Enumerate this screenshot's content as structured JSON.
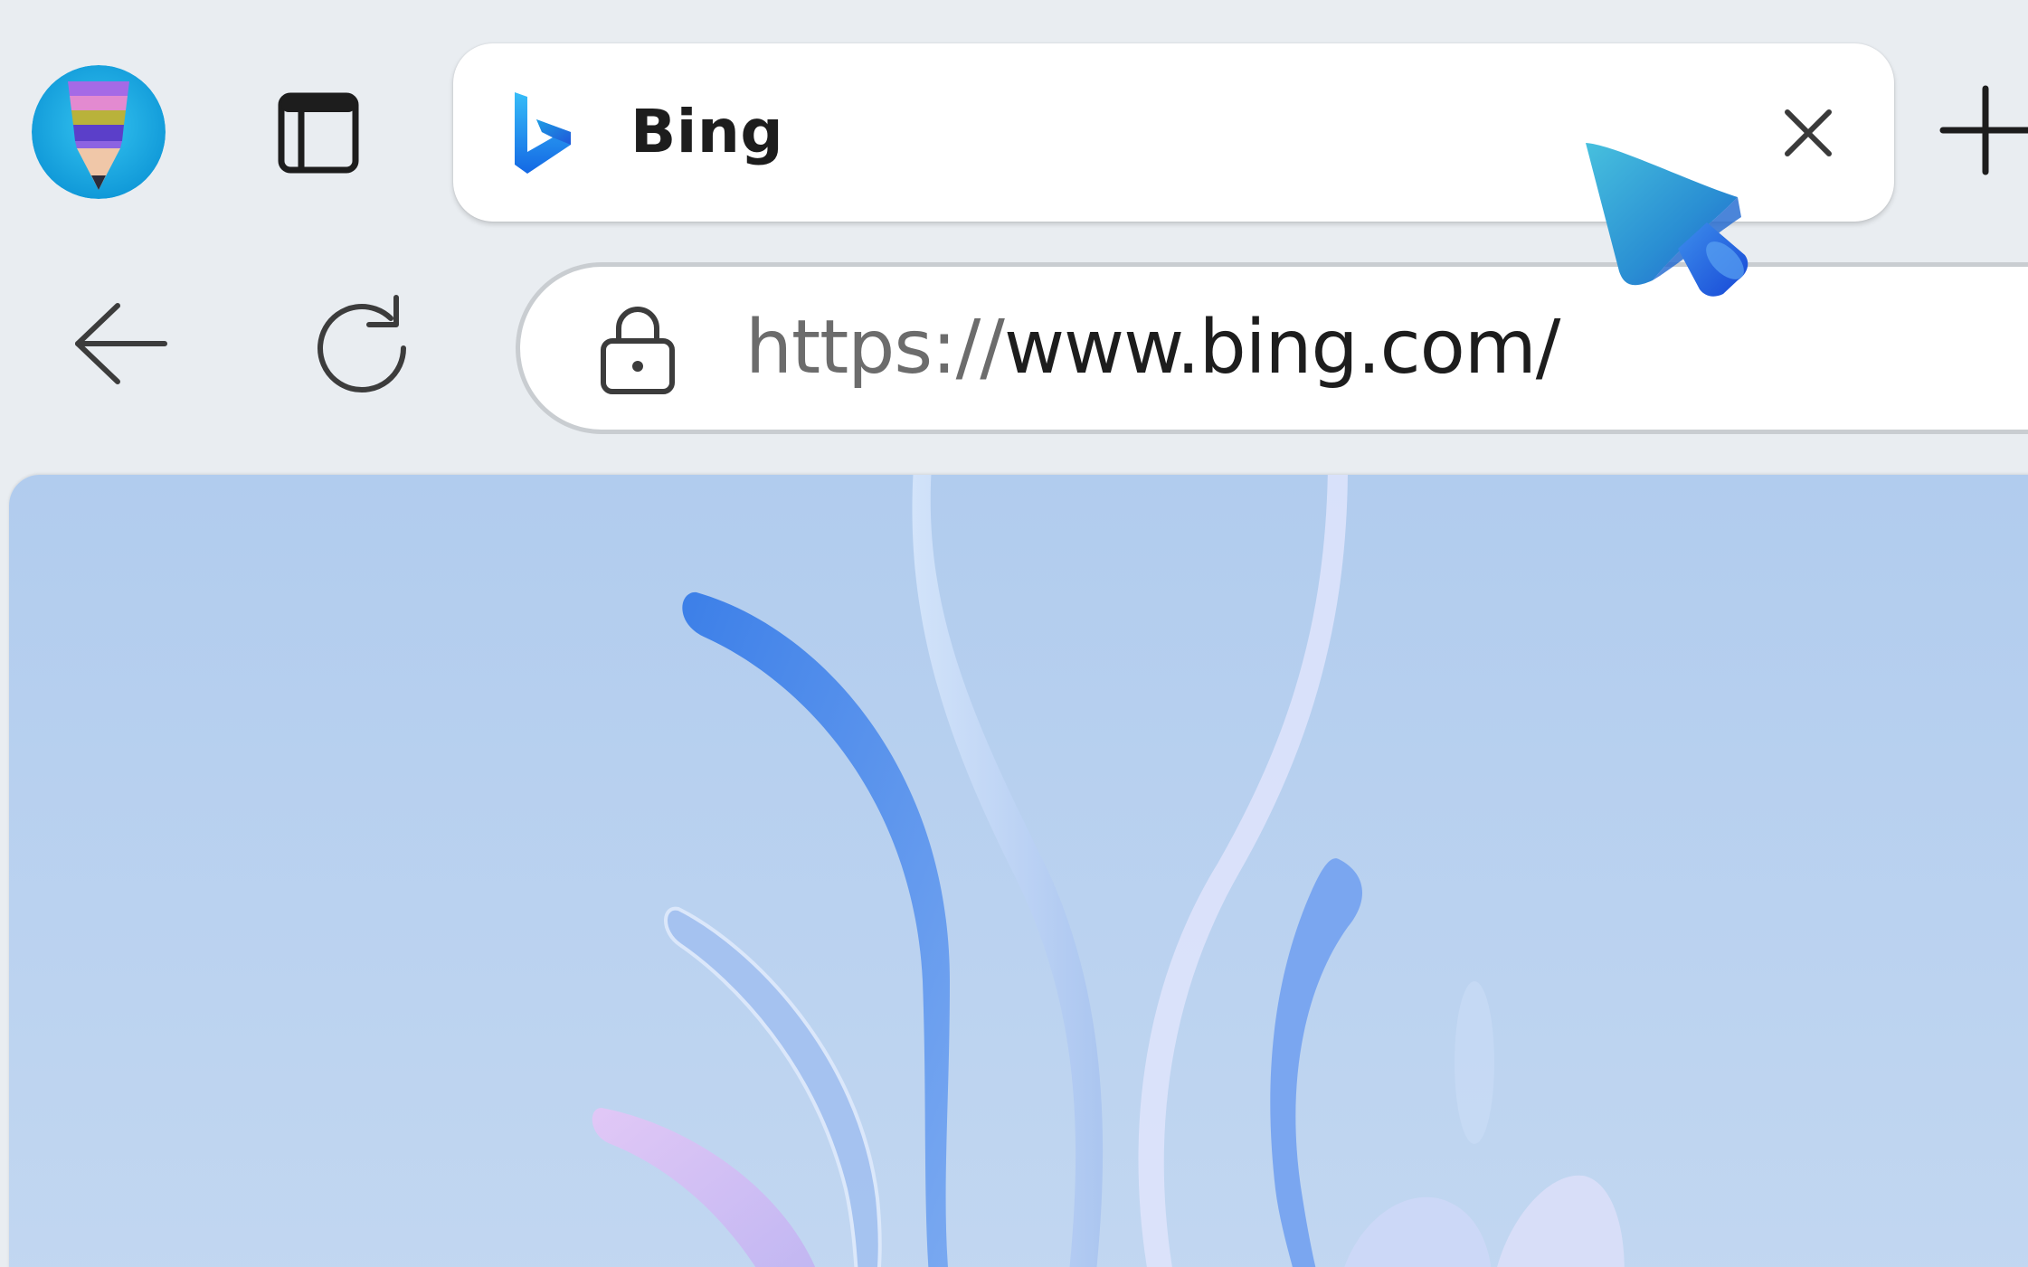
{
  "browser": {
    "profile": {
      "avatar_icon": "pencil-avatar-icon"
    },
    "toolbar": {
      "vertical_tabs_icon": "vertical-tabs-icon",
      "new_tab_icon": "plus-icon",
      "back_icon": "arrow-left-icon",
      "refresh_icon": "refresh-icon"
    },
    "active_tab": {
      "title": "Bing",
      "favicon": "bing-logo-icon",
      "close_icon": "close-icon"
    },
    "address_bar": {
      "lock_icon": "lock-icon",
      "url_scheme": "https://",
      "url_host": "www.bing.com/"
    },
    "content": {
      "wallpaper": "abstract-blue-flower-wallpaper"
    },
    "cursor_icon": "3d-pointer-cursor-icon"
  },
  "colors": {
    "chrome_background": "#e9edf1",
    "tab_background": "#ffffff",
    "text_primary": "#1d1d1d",
    "text_muted": "#6c6c6c",
    "bing_blue": "#1b6ee8",
    "wallpaper_sky": "#b7d0ef"
  }
}
